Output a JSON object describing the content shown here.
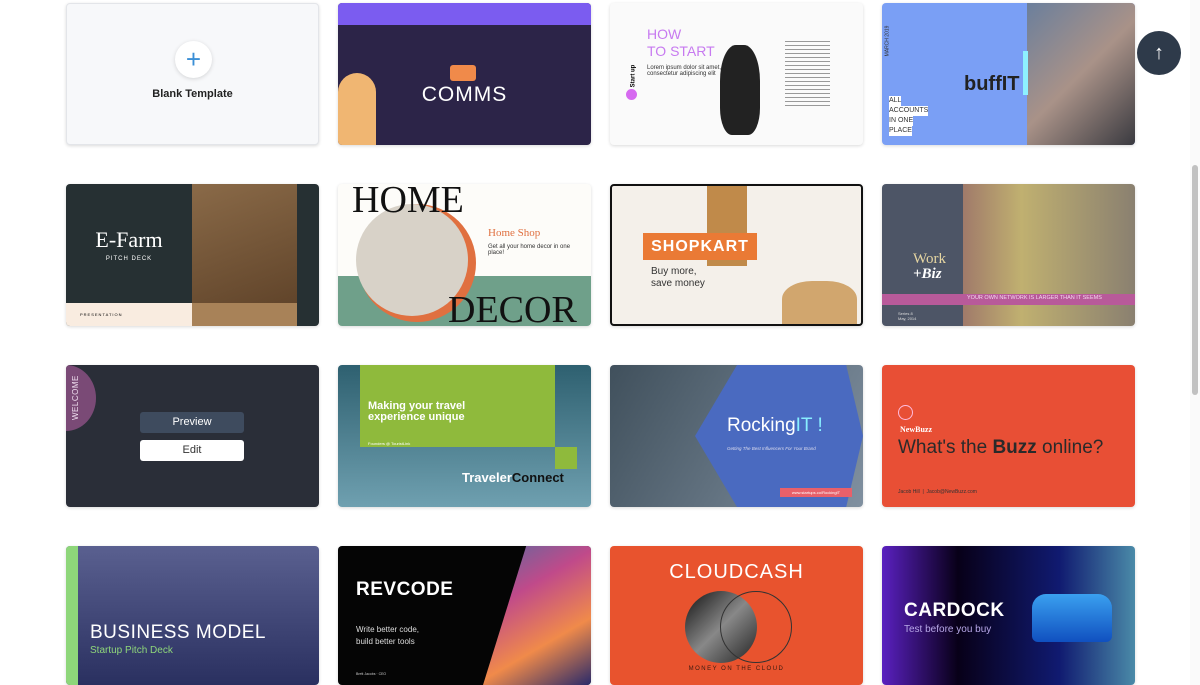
{
  "blank": {
    "label": "Blank Template",
    "icon": "plus-icon"
  },
  "templates": [
    {
      "title": "COMMS"
    },
    {
      "title_line1": "HOW",
      "title_line2": "TO START",
      "body": "Lorem ipsum dolor sit amet, consectetur adipiscing elit",
      "side": "Start up"
    },
    {
      "title": "buffIT",
      "tag1": "ALL",
      "tag2": "ACCOUNTS",
      "tag3": "IN ONE",
      "tag4": "PLACE",
      "side": "MARCH 2019"
    },
    {
      "title": "E-Farm",
      "subtitle": "PITCH DECK",
      "footer": "PRESENTATION"
    },
    {
      "top": "HOME",
      "bottom": "DECOR",
      "brand": "Home Shop",
      "body": "Get all your home decor in one place!"
    },
    {
      "title": "SHOPKART",
      "subtitle_line1": "Buy more,",
      "subtitle_line2": "save money"
    },
    {
      "title_line1": "Work",
      "title_line2": "+Biz",
      "banner": "YOUR OWN NETWORK IS LARGER THAN IT SEEMS",
      "series": "Series 8",
      "date": "May, 2014"
    },
    {
      "side": "WELCOME",
      "preview_label": "Preview",
      "edit_label": "Edit"
    },
    {
      "title": "Making your travel experience unique",
      "byline": "Founders @ TouristLink",
      "brand1": "Traveler",
      "brand2": "Connect"
    },
    {
      "title1": "Rocking",
      "title2": "IT !",
      "subtitle": "Getting The Best Influencers For Your Brand",
      "url": "www.startups.co/RockingIT"
    },
    {
      "brand": "NewBuzz",
      "title_pre": "What's the ",
      "title_bold": "Buzz",
      "title_post": " online?",
      "footer": "Jacob Hill  |  Jacob@NewBuzz.com"
    },
    {
      "title": "BUSINESS MODEL",
      "subtitle": "Startup Pitch Deck"
    },
    {
      "title": "REVCODE",
      "tagline_line1": "Write better code,",
      "tagline_line2": "build better tools",
      "footer": "Brett Jacobs · CEO"
    },
    {
      "title": "CLOUDCASH",
      "subtitle": "MONEY ON THE CLOUD"
    },
    {
      "title": "CARDOCK",
      "subtitle": "Test before you buy"
    }
  ],
  "scroll_top": {
    "icon": "arrow-up-icon"
  }
}
